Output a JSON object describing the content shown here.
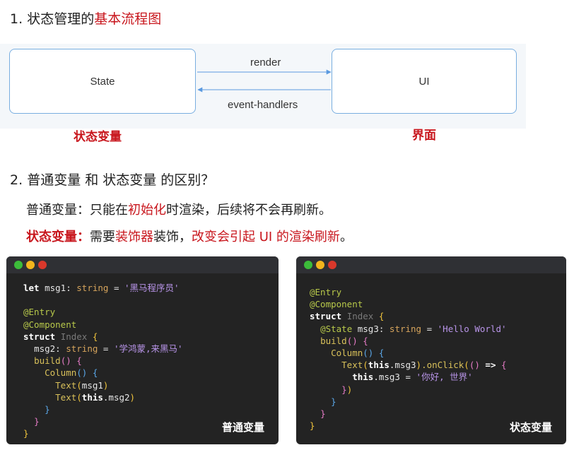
{
  "section1": {
    "number": "1.",
    "title_black": "状态管理的",
    "title_red": "基本流程图"
  },
  "flow": {
    "state_box": "State",
    "ui_box": "UI",
    "render_label": "render",
    "events_label": "event-handlers",
    "state_caption": "状态变量",
    "ui_caption": "界面"
  },
  "section2": {
    "number": "2.",
    "title": "普通变量 和 状态变量 的区别？",
    "line1": {
      "a": "普通变量：只能在",
      "b": "初始化",
      "c": "时渲染，后续将不会再刷新。"
    },
    "line2": {
      "a": "状态变量：",
      "b": "需要",
      "c": "装饰器",
      "d": "装饰，",
      "e": "改变会引起 UI 的渲染刷新",
      "f": "。"
    }
  },
  "code_left": {
    "label": "普通变量",
    "kw_let": "let",
    "msg1": " msg1",
    "type1": "string",
    "str1": "'黑马程序员'",
    "entry": "@Entry",
    "component": "@Component",
    "kw_struct": "struct",
    "cls_index": "Index",
    "msg2": "msg2",
    "type2": "string",
    "str2": "'学鸿蒙,来黑马'",
    "build": "build",
    "column": "Column",
    "text1": "Text",
    "arg1": "msg1",
    "text2": "Text",
    "kw_this": "this",
    "arg2": ".msg2"
  },
  "code_right": {
    "label": "状态变量",
    "entry": "@Entry",
    "component": "@Component",
    "kw_struct": "struct",
    "cls_index": "Index",
    "state": "@State",
    "msg3": " msg3",
    "type3": "string",
    "str3": "'Hello World'",
    "build": "build",
    "column": "Column",
    "text": "Text",
    "kw_this": "this",
    "arg": ".msg3",
    "onclick": ".onClick",
    "kw_this2": "this",
    "assign": ".msg3 = ",
    "str4": "'你好, 世界'"
  },
  "colors": {
    "accent_red": "#c8161d",
    "box_border": "#79aee0",
    "arrow": "#5b9ae0",
    "code_bg": "#232323"
  }
}
